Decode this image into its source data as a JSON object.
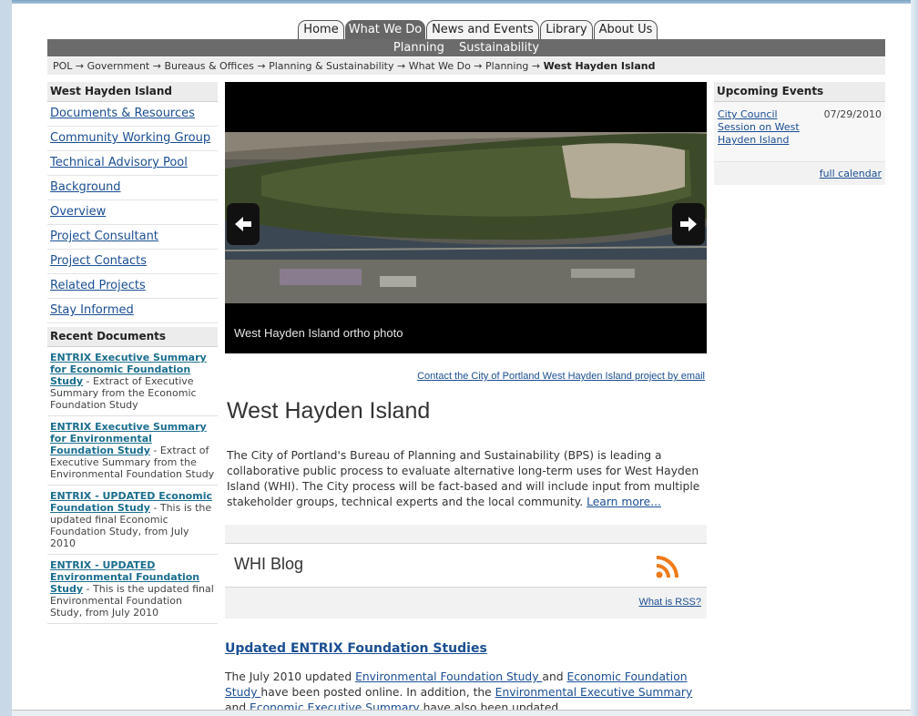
{
  "nav": {
    "tabs": [
      {
        "label": "Home"
      },
      {
        "label": "What We Do"
      },
      {
        "label": "News and Events"
      },
      {
        "label": "Library"
      },
      {
        "label": "About Us"
      }
    ],
    "subnav": [
      "Planning",
      "Sustainability"
    ]
  },
  "breadcrumb": {
    "trail": "POL → Government → Bureaus & Offices → Planning & Sustainability → What We Do → Planning →",
    "current": "West Hayden Island"
  },
  "sidebar": {
    "heading": "West Hayden Island",
    "links": [
      "Documents & Resources",
      "Community Working Group",
      "Technical Advisory Pool",
      "Background",
      "Overview",
      "Project Consultant",
      "Project Contacts",
      "Related Projects",
      "Stay Informed"
    ],
    "recent_heading": "Recent Documents",
    "recent_docs": [
      {
        "title": "ENTRIX Executive Summary for Economic Foundation Study",
        "desc": " - Extract of Executive Summary from the Economic Foundation Study"
      },
      {
        "title": "ENTRIX Executive Summary for Environmental Foundation Study",
        "desc": " - Extract of Executive Summary from the Environmental Foundation Study"
      },
      {
        "title": "ENTRIX - UPDATED Economic Foundation Study",
        "desc": " - This is the updated final Economic Foundation Study, from July 2010"
      },
      {
        "title": "ENTRIX - UPDATED Environmental Foundation Study",
        "desc": " - This is the updated final Environmental Foundation Study, from July 2010"
      }
    ]
  },
  "main": {
    "slideshow_caption": "West Hayden Island ortho photo",
    "contact_link": "Contact the City of Portland West Hayden Island project by email",
    "title": "West Hayden Island",
    "intro": "The City of Portland's Bureau of Planning and Sustainability (BPS) is leading a collaborative public process to evaluate alternative long-term uses for West Hayden Island (WHI). The City process will be fact-based and will include input from multiple stakeholder groups, technical experts and the local community. ",
    "learn_more": "Learn more...",
    "blog_title": "WHI Blog",
    "rss_help": "What is RSS?",
    "post_title": "Updated ENTRIX Foundation Studies",
    "post": {
      "t1": "The July 2010 updated ",
      "l1": "Environmental Foundation Study ",
      "t2": "and ",
      "l2": "Economic Foundation Study ",
      "t3": "have been posted online.  In addition, the ",
      "l3": "Environmental Executive Summary",
      "t4": " and ",
      "l4": "Economic Executive Summary",
      "t5": " have also been updated."
    }
  },
  "events": {
    "heading": "Upcoming Events",
    "items": [
      {
        "title": "City Council Session on West Hayden Island",
        "date": "07/29/2010"
      }
    ],
    "full_calendar": "full calendar"
  },
  "colors": {
    "link": "#1a4e92",
    "nav_active": "#666666",
    "subnav_bg": "#6b6b6b",
    "rss": "#f07a1a"
  },
  "icons": [
    "left-arrow-icon",
    "right-arrow-icon",
    "rss-icon"
  ]
}
